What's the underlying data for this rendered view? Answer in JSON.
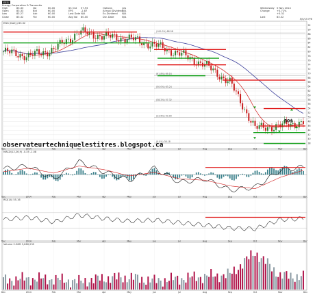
{
  "header": {
    "ticker_badge": "EEG",
    "company": "Energy Corporation & Tranzactio",
    "rows": [
      [
        "High",
        "83.33",
        "Vol",
        "60.00",
        "Sh Out",
        "57.93",
        "Options",
        "yes",
        "Wednesday",
        "5 Nov 2014"
      ],
      [
        "Open",
        "83.33",
        "Bid",
        "60.00",
        "EPS",
        "-2.87",
        "Annual Dividend",
        "N/A",
        "Change",
        "+0.72%"
      ],
      [
        "Low",
        "83.27",
        "Ask",
        "60.00",
        "Last Date",
        "N/A",
        "Ex-Dividend",
        "N/A",
        "",
        "+0.32"
      ],
      [
        "Close",
        "83.32",
        "Yld",
        "60.00",
        "Avg Vol",
        "80.00",
        "Div. Date",
        "N/A",
        "Last",
        "83.32"
      ]
    ],
    "right_footer": "5/5/15 P/E"
  },
  "price_panel": {
    "label": "ENG (Daily) 83.32",
    "watermark": "observateurtechniquelestitres.blogspot.ca",
    "price_target_text": "50$",
    "fib_labels": [
      "(100.0%) 88.58",
      "(61.8%) 69.16",
      "(50.0%) 63.24",
      "(38.2%) 57.32",
      "(23.6%) 50.00",
      "(0.0%) 38.18"
    ]
  },
  "macd_panel": {
    "label": "MACD(12,26,9) -0.35 -1.08"
  },
  "rsi_panel": {
    "label": "RSI(14) 55.16"
  },
  "volume_panel": {
    "label": "Volume 2.56M 3,660,235"
  },
  "x_axis_months": [
    "Dec",
    "2014",
    "Feb",
    "Mar",
    "Apr",
    "May",
    "Jun",
    "Jul",
    "Aug",
    "Sep",
    "Oct",
    "Nov",
    "Dec"
  ],
  "colors": {
    "up_candle": "#2f7d2f",
    "down_candle": "#c81e1e",
    "resistance": "#e01b1b",
    "support": "#14a01b",
    "ma_short": "#d11a1a",
    "ma_long": "#3b3f9b",
    "macd_hist": "#3a7f8a",
    "volume_up": "#8b9aa3",
    "volume_down": "#b0144a"
  },
  "chart_data": [
    {
      "type": "candlestick",
      "title": "ENG (Daily) 83.32",
      "ylim": [
        36,
        93
      ],
      "y_ticks": [
        38,
        40,
        42,
        44,
        46,
        48,
        50,
        52,
        54,
        56,
        58,
        60,
        62,
        64,
        66,
        68,
        70,
        72,
        74,
        76,
        78,
        80,
        82,
        84,
        86,
        88,
        90,
        92
      ],
      "x_categories": [
        "Dec",
        "2014",
        "Feb",
        "Mar",
        "Apr",
        "May",
        "Jun",
        "Jul",
        "Aug",
        "Sep",
        "Oct",
        "Nov",
        "Dec"
      ],
      "close_by_month": [
        80,
        78,
        81,
        89,
        87,
        86,
        83,
        79,
        74,
        66,
        45,
        46,
        48
      ],
      "horizontal_levels": [
        {
          "kind": "resistance",
          "value": 89
        },
        {
          "kind": "support",
          "value": 84
        },
        {
          "kind": "resistance",
          "value": 81
        },
        {
          "kind": "support",
          "value": 77
        },
        {
          "kind": "resistance",
          "value": 74
        },
        {
          "kind": "support",
          "value": 69
        },
        {
          "kind": "resistance",
          "value": 67
        },
        {
          "kind": "resistance",
          "value": 54
        },
        {
          "kind": "resistance",
          "value": 46
        },
        {
          "kind": "support",
          "value": 43
        },
        {
          "kind": "support",
          "value": 38
        }
      ],
      "fibonacci": [
        {
          "pct": 100.0,
          "value": 88.58
        },
        {
          "pct": 61.8,
          "value": 69.16
        },
        {
          "pct": 50.0,
          "value": 63.24
        },
        {
          "pct": 38.2,
          "value": 57.32
        },
        {
          "pct": 23.6,
          "value": 50.0
        },
        {
          "pct": 0.0,
          "value": 38.18
        }
      ],
      "annotation": {
        "text": "50$",
        "value": 50
      }
    },
    {
      "type": "bar",
      "title": "MACD(12,26,9) -0.35 -1.08",
      "ylim": [
        -3,
        3
      ],
      "macd": [
        0.8,
        1.2,
        -0.6,
        1.8,
        0.4,
        -0.8,
        0.9,
        -1.1,
        -0.6,
        -2.2,
        -1.8,
        0.6,
        1.1
      ],
      "signal": [
        0.4,
        0.9,
        0.2,
        1.2,
        0.7,
        -0.2,
        0.3,
        -0.6,
        -0.8,
        -1.6,
        -2.0,
        -0.4,
        0.7
      ],
      "horizontal_level": 1.0
    },
    {
      "type": "line",
      "title": "RSI(14) 55.16",
      "ylim": [
        0,
        100
      ],
      "values": [
        52,
        58,
        46,
        64,
        55,
        48,
        51,
        44,
        38,
        30,
        28,
        52,
        55
      ],
      "horizontal_level": 58
    },
    {
      "type": "bar",
      "title": "Volume 2.56M 3,660,235",
      "ylim": [
        0,
        10
      ],
      "values": [
        2.2,
        2.5,
        2.4,
        1.8,
        2.6,
        2.8,
        2.0,
        2.5,
        3.0,
        3.4,
        8.5,
        3.2,
        2.9
      ]
    }
  ]
}
